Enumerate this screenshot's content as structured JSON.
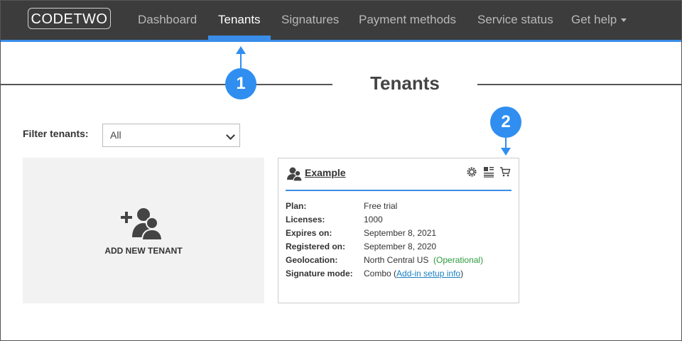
{
  "nav": {
    "logo": "CODETWO",
    "items": [
      {
        "label": "Dashboard"
      },
      {
        "label": "Tenants"
      },
      {
        "label": "Signatures"
      },
      {
        "label": "Payment methods"
      },
      {
        "label": "Service status"
      },
      {
        "label": "Get help"
      }
    ]
  },
  "page": {
    "title": "Tenants"
  },
  "callouts": {
    "one": "1",
    "two": "2"
  },
  "filter": {
    "label": "Filter tenants:",
    "selected": "All"
  },
  "add_tenant": {
    "label": "ADD NEW TENANT",
    "icon": "add-user-icon"
  },
  "tenant": {
    "name": "Example",
    "icons": [
      "settings-gear-icon",
      "license-list-icon",
      "cart-icon"
    ],
    "plan_label": "Plan:",
    "plan": "Free trial",
    "licenses_label": "Licenses:",
    "licenses": "1000",
    "expires_label": "Expires on:",
    "expires": "September 8, 2021",
    "registered_label": "Registered on:",
    "registered": "September 8, 2020",
    "geo_label": "Geolocation:",
    "geo": "North Central US",
    "geo_status": "(Operational)",
    "sigmode_label": "Signature mode:",
    "sigmode": "Combo",
    "sigmode_link": "Add-in setup info"
  },
  "colors": {
    "accent": "#3a8de8",
    "navbar": "#3c3c3c",
    "callout": "#2f8ef0",
    "status_ok": "#2e9a3c",
    "link": "#1a7fc4"
  }
}
